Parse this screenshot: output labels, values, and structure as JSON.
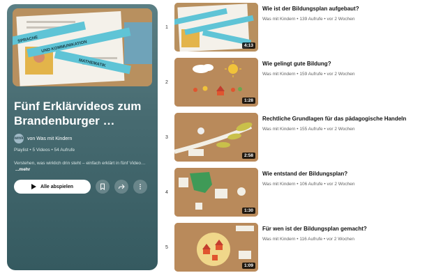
{
  "playlist": {
    "title": "Fünf Erklärvideos zum Brandenburger …",
    "channel_prefix": "von",
    "channel": "Was mit Kindern",
    "avatar_text": "wmk",
    "meta": "Playlist • 5 Videos • 54 Aufrufe",
    "description": "Verstehen, was wirklich drin steht – einfach erklärt in fünf Video…",
    "more": "...mehr",
    "play_all": "Alle abspielen",
    "hero_strips": [
      "SPRACHE",
      "UND KOMMUNIKATION",
      "MATHEMATIK"
    ]
  },
  "videos": [
    {
      "index": "1",
      "title": "Wie ist der Bildungsplan aufgebaut?",
      "channel": "Was mit Kindern",
      "views": "139 Aufrufe",
      "age": "vor 2 Wochen",
      "duration": "4:13"
    },
    {
      "index": "2",
      "title": "Wie gelingt gute Bildung?",
      "channel": "Was mit Kindern",
      "views": "159 Aufrufe",
      "age": "vor 2 Wochen",
      "duration": "1:28"
    },
    {
      "index": "3",
      "title": "Rechtliche Grundlagen für das pädagogische Handeln",
      "channel": "Was mit Kindern",
      "views": "155 Aufrufe",
      "age": "vor 2 Wochen",
      "duration": "2:58"
    },
    {
      "index": "4",
      "title": "Wie entstand der Bildungsplan?",
      "channel": "Was mit Kindern",
      "views": "106 Aufrufe",
      "age": "vor 2 Wochen",
      "duration": "1:30"
    },
    {
      "index": "5",
      "title": "Für wen ist der Bildungsplan gemacht?",
      "channel": "Was mit Kindern",
      "views": "116 Aufrufe",
      "age": "vor 2 Wochen",
      "duration": "1:09"
    }
  ],
  "colors": {
    "panel": "#466a70",
    "accent_strip": "#5fc4d6",
    "thumb_board": "#b98a5b"
  }
}
